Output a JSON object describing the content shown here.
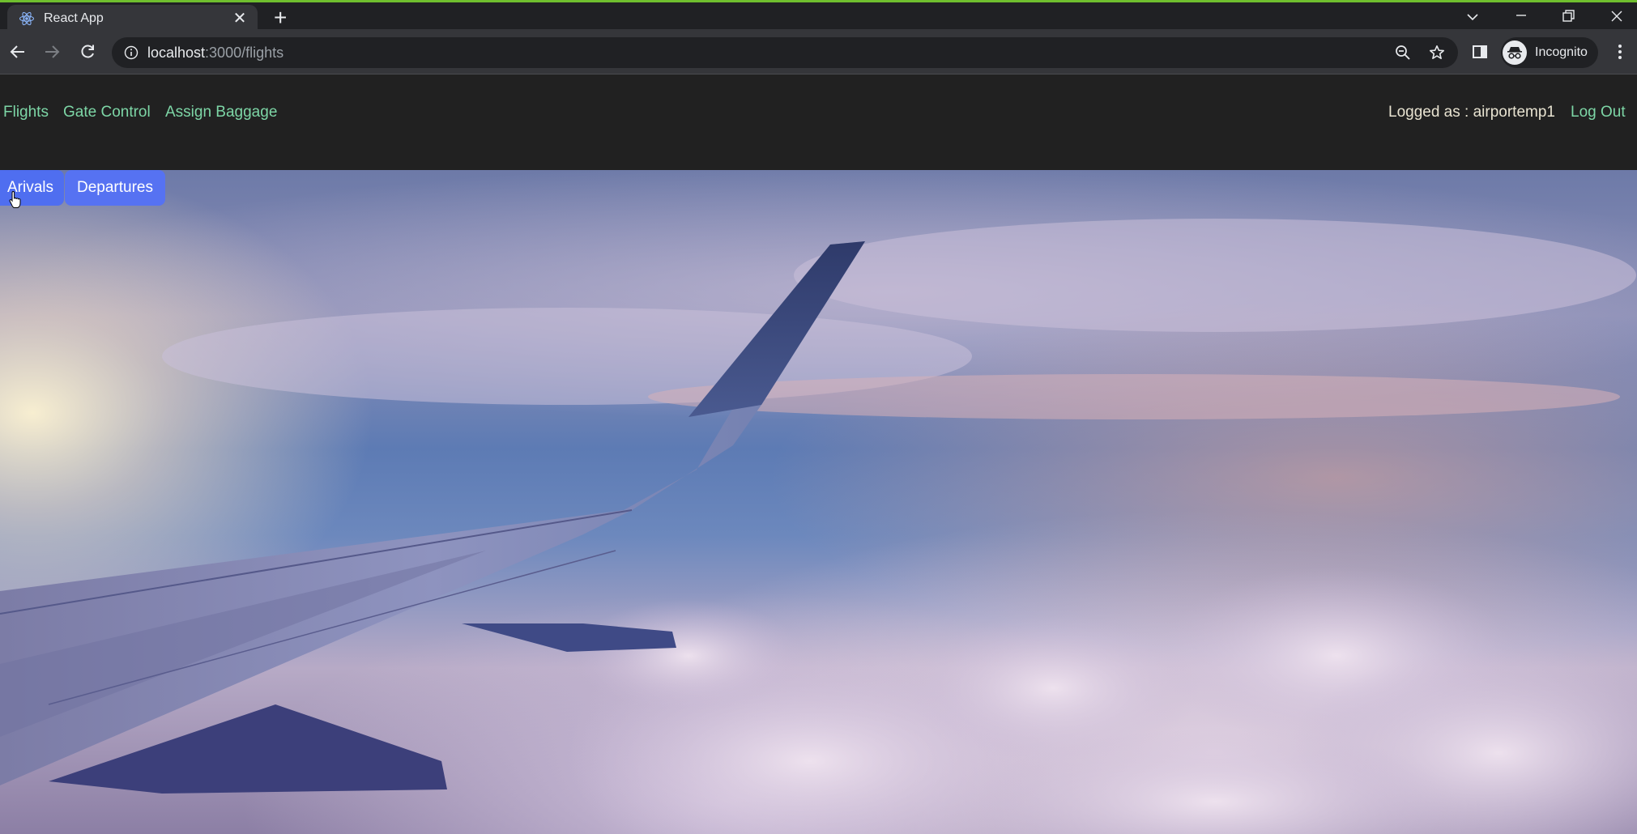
{
  "browser": {
    "tab_title": "React App",
    "url_host": "localhost",
    "url_path": ":3000/flights",
    "profile_label": "Incognito",
    "icons": [
      "react-favicon",
      "close-icon",
      "plus-icon",
      "chevron-down-icon",
      "minimize-icon",
      "restore-icon",
      "window-close-icon",
      "back-icon",
      "forward-icon",
      "reload-icon",
      "info-icon",
      "zoom-icon",
      "star-icon",
      "side-panel-icon",
      "incognito-icon",
      "menu-icon"
    ]
  },
  "nav": {
    "links": [
      "Flights",
      "Gate Control",
      "Assign Baggage"
    ],
    "logged_as": "Logged as : airportemp1",
    "logout": "Log Out"
  },
  "flights": {
    "arrivals_label": "Arivals",
    "departures_label": "Departures"
  },
  "colors": {
    "nav_link": "#7dd6a6",
    "button": "#4f6ef0",
    "nav_bg": "#212121"
  }
}
